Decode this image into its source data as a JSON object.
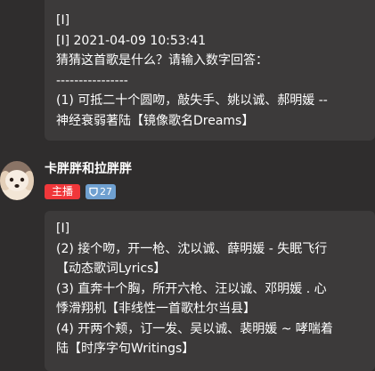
{
  "messages": [
    {
      "lines": [
        "[I]",
        "[I] 2021-04-09 10:53:41",
        "猜猜这首歌是什么？请输入数字回答：",
        "----------------",
        "(1) 可抵二十个圆吻，敲失手、姚以诚、郝明媛 --",
        "神经衰弱著陆【镜像歌名Dreams】"
      ]
    },
    {
      "sender": {
        "name": "卡胖胖和拉胖胖",
        "role_badge": "主播",
        "level_badge": "27",
        "level_icon": "level-shield-icon"
      },
      "lines": [
        "[I]",
        "(2) 接个吻，开一枪、沈以诚、薛明媛 - 失眠飞行",
        "【动态歌词Lyrics】",
        "(3) 直奔十个胸，所开六枪、汪以诚、邓明媛 . 心",
        "悸滑翔机【非线性一首歌杜尔当县】",
        "(4) 开两个颊，订一发、吴以诚、裴明媛 ~ 哮喘着",
        "陆【时序字句Writings】"
      ]
    }
  ],
  "colors": {
    "background": "#2f2d2d",
    "bubble": "#3c3a3a",
    "host_badge": "#f0373a",
    "level_badge": "#6fa0d0"
  }
}
